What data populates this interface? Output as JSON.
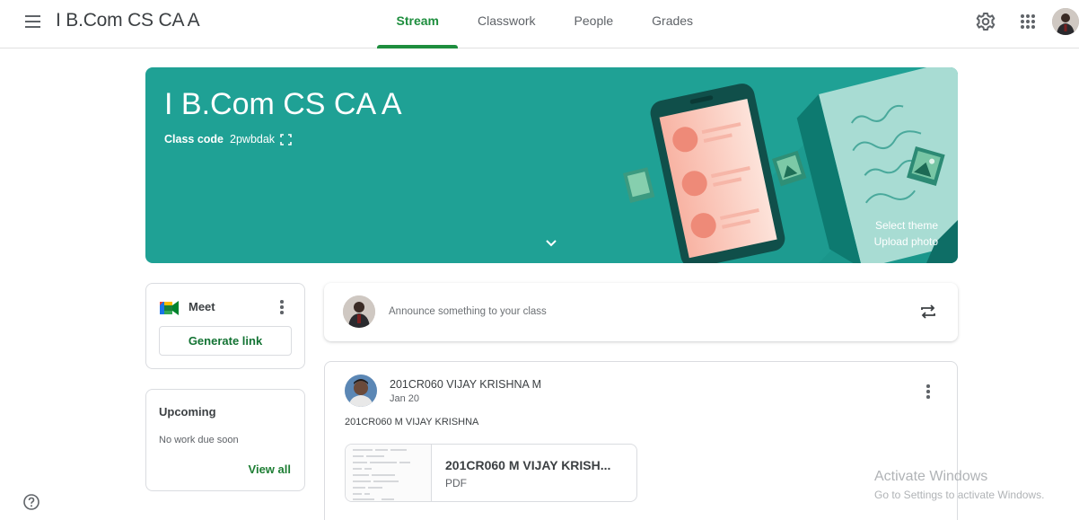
{
  "header": {
    "title": "I B.Com CS CA A",
    "tabs": [
      {
        "label": "Stream",
        "active": true
      },
      {
        "label": "Classwork",
        "active": false
      },
      {
        "label": "People",
        "active": false
      },
      {
        "label": "Grades",
        "active": false
      }
    ],
    "icons": [
      "menu-icon",
      "gear-icon",
      "apps-grid-icon",
      "avatar"
    ]
  },
  "banner": {
    "title": "I B.Com CS CA A",
    "class_code_label": "Class code",
    "class_code": "2pwbdak",
    "select_theme": "Select theme",
    "upload_photo": "Upload photo",
    "background_color": "#1fa195"
  },
  "meet": {
    "label": "Meet",
    "generate_link": "Generate link"
  },
  "upcoming": {
    "title": "Upcoming",
    "empty_text": "No work due soon",
    "view_all": "View all"
  },
  "announce": {
    "placeholder": "Announce something to your class"
  },
  "post": {
    "author": "201CR060 VIJAY KRISHNA M",
    "date": "Jan 20",
    "body": "201CR060 M VIJAY KRISHNA",
    "attachment": {
      "name": "201CR060 M VIJAY KRISH...",
      "type": "PDF"
    }
  },
  "watermark": {
    "line1": "Activate Windows",
    "line2": "Go to Settings to activate Windows."
  },
  "colors": {
    "accent": "#1e8e3e",
    "banner": "#1fa195"
  }
}
